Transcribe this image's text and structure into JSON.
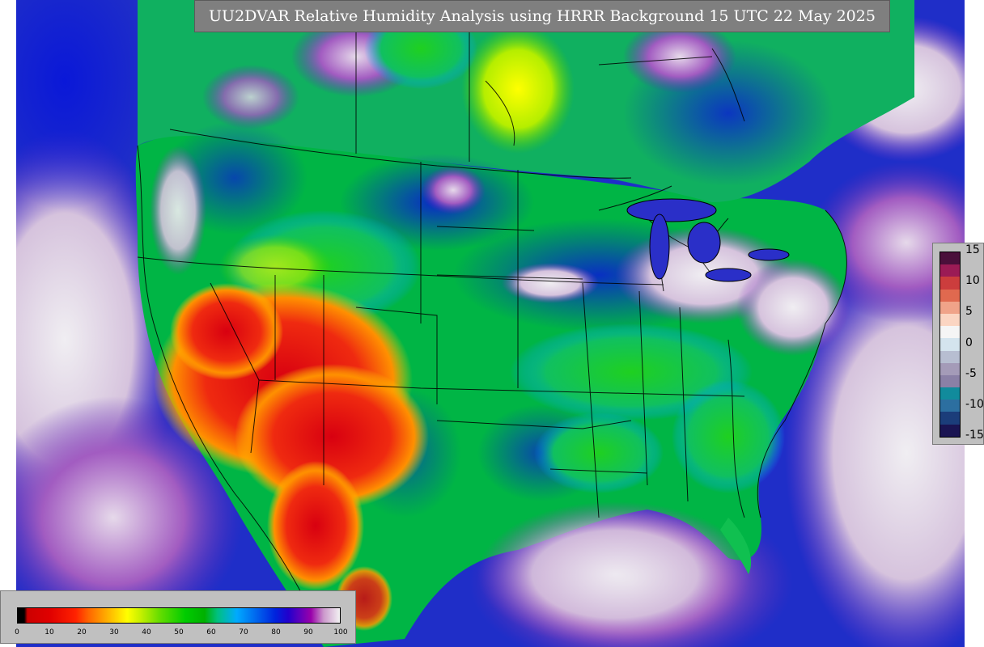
{
  "title": "UU2DVAR Relative Humidity Analysis using HRRR Background 15 UTC 22 May 2025",
  "diff_legend": {
    "labels": [
      "15",
      "10",
      "5",
      "0",
      "-5",
      "-10",
      "-15"
    ],
    "colors": [
      "#4a0f3a",
      "#9b1b55",
      "#cc3d3d",
      "#e0694f",
      "#f0a389",
      "#fbd5c2",
      "#f5f5f5",
      "#d4e4ee",
      "#b7bed1",
      "#a49bb8",
      "#8a80a6",
      "#118b9c",
      "#2c6fa0",
      "#1b3d7a",
      "#1a1452"
    ]
  },
  "rh_legend": {
    "ticks": [
      "0",
      "10",
      "20",
      "30",
      "40",
      "50",
      "60",
      "70",
      "80",
      "90",
      "100"
    ]
  },
  "map": {
    "ocean_color": "#2a3ad0",
    "land_moist_color": "#00b53a",
    "arid_color": "#e31a1c"
  }
}
